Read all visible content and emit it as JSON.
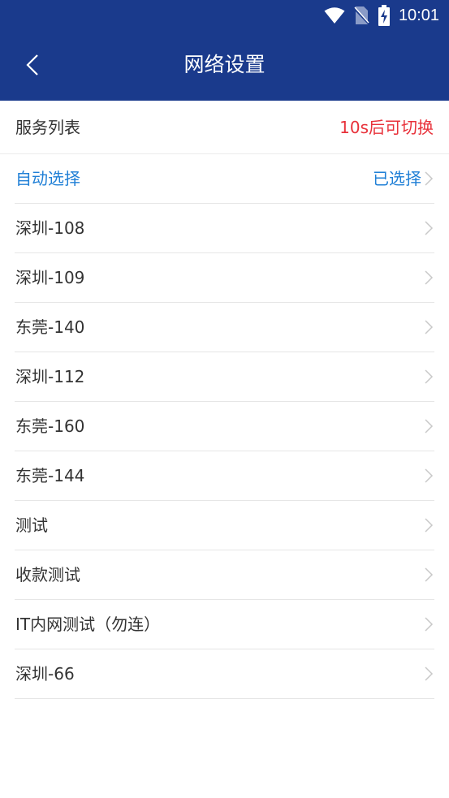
{
  "status_bar": {
    "time": "10:01",
    "icons": [
      "wifi-icon",
      "no-sim-icon",
      "battery-charging-icon"
    ]
  },
  "header": {
    "title": "网络设置",
    "back_icon": "chevron-left-icon"
  },
  "list_header": {
    "title": "服务列表",
    "countdown": "10s后可切换"
  },
  "servers": [
    {
      "label": "自动选择",
      "status": "已选择",
      "active": true
    },
    {
      "label": "深圳-108"
    },
    {
      "label": "深圳-109"
    },
    {
      "label": "东莞-140"
    },
    {
      "label": "深圳-112"
    },
    {
      "label": "东莞-160"
    },
    {
      "label": "东莞-144"
    },
    {
      "label": "测试"
    },
    {
      "label": "收款测试"
    },
    {
      "label": "IT内网测试（勿连）"
    },
    {
      "label": "深圳-66"
    }
  ],
  "colors": {
    "header_bg": "#1a3a8c",
    "accent_blue": "#1f7fd6",
    "countdown_red": "#e8313a"
  }
}
